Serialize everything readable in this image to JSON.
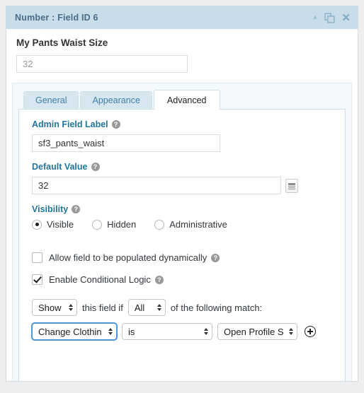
{
  "header": {
    "title": "Number : Field ID 6",
    "collapse_icon": "caret-up-icon",
    "duplicate_icon": "duplicate-icon",
    "close_icon": "close-icon"
  },
  "preview": {
    "label": "My Pants Waist Size",
    "input_value": "32",
    "input_placeholder": "32"
  },
  "tabs": [
    {
      "label": "General",
      "active": false
    },
    {
      "label": "Appearance",
      "active": false
    },
    {
      "label": "Advanced",
      "active": true
    }
  ],
  "settings": {
    "admin_field_label": {
      "label": "Admin Field Label",
      "help": "?",
      "value": "sf3_pants_waist",
      "placeholder": ""
    },
    "default_value": {
      "label": "Default Value",
      "help": "?",
      "value": "32",
      "placeholder": "",
      "merge_tag_icon": "merge-tag-icon"
    },
    "visibility": {
      "label": "Visibility",
      "help": "?",
      "options": [
        {
          "label": "Visible",
          "checked": true
        },
        {
          "label": "Hidden",
          "checked": false
        },
        {
          "label": "Administrative",
          "checked": false
        }
      ]
    },
    "allow_dynamic": {
      "label": "Allow field to be populated dynamically",
      "help": "?",
      "checked": false
    },
    "conditional_logic": {
      "label": "Enable Conditional Logic",
      "help": "?",
      "checked": true,
      "action_select": "Show",
      "text_before_match": "this field if",
      "match_select": "All",
      "text_after_match": "of the following match:",
      "rule": {
        "field_select": "Change Clothin",
        "operator_select": "is",
        "value_select": "Open Profile Se",
        "add_icon": "plus-circle-icon"
      }
    }
  },
  "colors": {
    "header_bg": "#c8dce9",
    "header_text": "#4a6c86",
    "label_blue": "#21759b",
    "tab_inactive_bg": "#d6e7f1",
    "panel_bg": "#f4f9fc",
    "focus_blue": "#4f94d4"
  }
}
